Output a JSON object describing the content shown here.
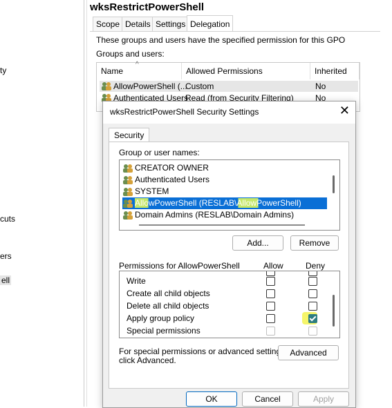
{
  "left_pane": {
    "items": [
      {
        "label": "ty"
      },
      {
        "label": "cuts"
      },
      {
        "label": "ers"
      },
      {
        "label": "ell",
        "selected": true
      }
    ]
  },
  "gpo": {
    "title": "wksRestrictPowerShell",
    "tabs": [
      {
        "label": "Scope"
      },
      {
        "label": "Details"
      },
      {
        "label": "Settings"
      },
      {
        "label": "Delegation",
        "active": true
      }
    ],
    "description": "These groups and users have the specified permission for this GPO",
    "groups_label": "Groups and users:",
    "columns": [
      "Name",
      "Allowed Permissions",
      "Inherited"
    ],
    "rows": [
      {
        "name": "AllowPowerShell (...",
        "permissions": "Custom",
        "inherited": "No"
      },
      {
        "name": "Authenticated Users",
        "permissions": "Read (from Security Filtering)",
        "inherited": "No"
      }
    ]
  },
  "dialog": {
    "title": "wksRestrictPowerShell Security Settings",
    "tab": "Security",
    "group_label": "Group or user names:",
    "principals": [
      {
        "name": "CREATOR OWNER"
      },
      {
        "name": "Authenticated Users"
      },
      {
        "name": "SYSTEM"
      },
      {
        "name": "AllowPowerShell (RESLAB\\AllowPowerShell)",
        "selected": true
      },
      {
        "name": "Domain Admins (RESLAB\\Domain Admins)"
      }
    ],
    "add_label": "Add...",
    "remove_label": "Remove",
    "permissions_label": "Permissions for AllowPowerShell",
    "allow_label": "Allow",
    "deny_label": "Deny",
    "permissions": [
      {
        "name": "Write",
        "allow": false,
        "deny": false
      },
      {
        "name": "Create all child objects",
        "allow": false,
        "deny": false
      },
      {
        "name": "Delete all child objects",
        "allow": false,
        "deny": false
      },
      {
        "name": "Apply group policy",
        "allow": false,
        "deny": true
      },
      {
        "name": "Special permissions",
        "allow": false,
        "deny": false,
        "disabled": true
      }
    ],
    "special_text_1": "For special permissions or advanced settings,",
    "special_text_2": "click Advanced.",
    "advanced_label": "Advanced",
    "ok_label": "OK",
    "cancel_label": "Cancel",
    "apply_label": "Apply"
  },
  "colors": {
    "highlight": "#f5f56a",
    "selection": "#0a6fd6",
    "accent": "#0067c0"
  }
}
